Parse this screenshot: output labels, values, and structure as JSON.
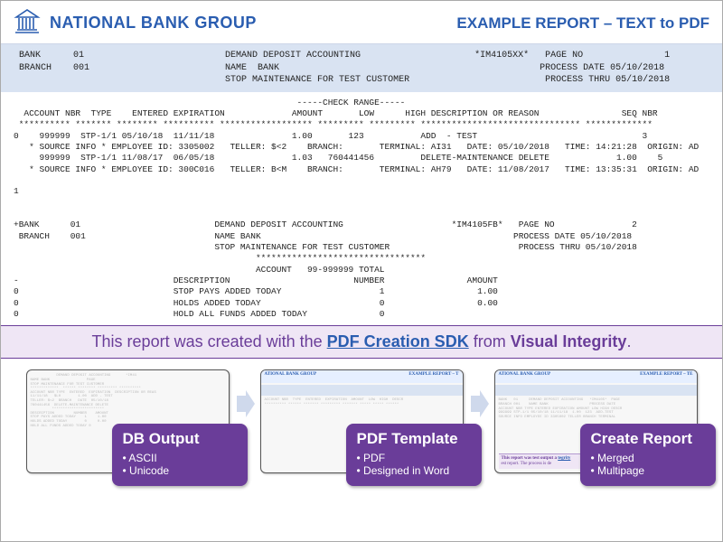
{
  "header": {
    "org": "NATIONAL BANK GROUP",
    "right": "EXAMPLE REPORT – TEXT to PDF"
  },
  "banner": " BANK      01                          DEMAND DEPOSIT ACCOUNTING                     *IM4105XX*   PAGE NO               1\n BRANCH    001                         NAME  BANK                                                PROCESS DATE 05/10/2018\n                                       STOP MAINTENANCE FOR TEST CUSTOMER                         PROCESS THRU 05/10/2018",
  "report": "                                                       -----CHECK RANGE-----\n  ACCOUNT NBR  TYPE    ENTERED EXPIRATION             AMOUNT       LOW      HIGH DESCRIPTION OR REASON                SEQ NBR\n ********** ******* ******** ********** ****************** ********* ********* ******************************* *************\n0    999999  STP-1/1 05/10/18  11/11/18               1.00       123           ADD  - TEST                                3\n   * SOURCE INFO * EMPLOYEE ID: 3305002   TELLER: $<2    BRANCH:       TERMINAL: AI31   DATE: 05/10/2018   TIME: 14:21:28  ORIGIN: AD\n     999999  STP-1/1 11/08/17  06/05/18               1.03   760441456         DELETE-MAINTENANCE DELETE             1.00    5\n   * SOURCE INFO * EMPLOYEE ID: 300C016   TELLER: B<M    BRANCH:       TERMINAL: AH79   DATE: 11/08/2017   TIME: 13:35:31  ORIGIN: AD\n\n1\n\n\n+BANK      01                          DEMAND DEPOSIT ACCOUNTING                     *IM4105FB*   PAGE NO               2\n BRANCH    001                         NAME BANK                                                 PROCESS DATE 05/10/2018\n                                       STOP MAINTENANCE FOR TEST CUSTOMER                         PROCESS THRU 05/10/2018\n                                               *********************************\n                                               ACCOUNT   99-999999 TOTAL\n-                              DESCRIPTION                        NUMBER                AMOUNT\n0                              STOP PAYS ADDED TODAY                   1                  1.00\n0                              HOLDS ADDED TODAY                       0                  0.00\n0                              HOLD ALL FUNDS ADDED TODAY              0",
  "promo": {
    "pre": "This report was created with the ",
    "link": "PDF Creation SDK",
    "mid": " from ",
    "brand": "Visual Integrity",
    "post": "."
  },
  "flow": {
    "thumb2_left": "ATIONAL BANK GROUP",
    "thumb2_right": "EXAMPLE REPORT – T",
    "thumb3_left": "ATIONAL BANK GROUP",
    "thumb3_right": "EXAMPLE REPORT – TE",
    "thumb3_foot1": "This report was test output a",
    "thumb3_foot2": "est report. The process is de",
    "cards": [
      {
        "title": "DB Output",
        "bullets": [
          "ASCII",
          "Unicode"
        ]
      },
      {
        "title": "PDF Template",
        "bullets": [
          "PDF",
          "Designed in Word"
        ]
      },
      {
        "title": "Create Report",
        "bullets": [
          "Merged",
          "Multipage"
        ]
      }
    ]
  }
}
